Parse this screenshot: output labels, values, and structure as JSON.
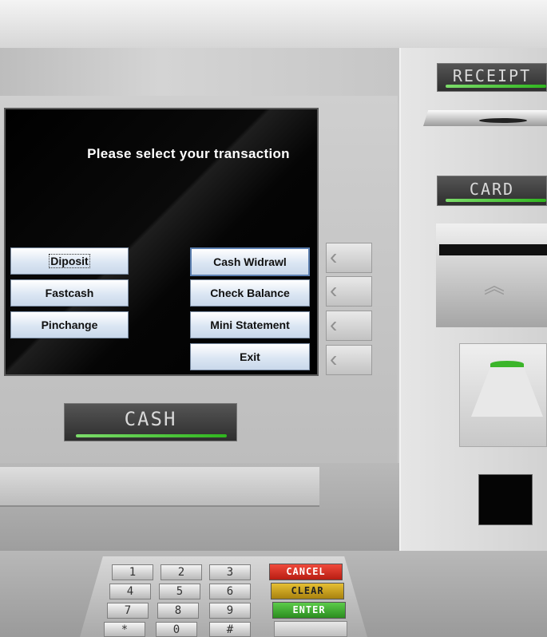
{
  "screen": {
    "prompt": "Please select your transaction",
    "buttons_left": [
      "Diposit",
      "Fastcash",
      "Pinchange"
    ],
    "buttons_right": [
      "Cash Widrawl",
      "Check Balance",
      "Mini Statement",
      "Exit"
    ]
  },
  "side_key_glyph": "‹",
  "labels": {
    "receipt": "RECEIPT",
    "card": "CARD",
    "cash": "CASH"
  },
  "card_chevron": "︽",
  "keypad": {
    "keys": [
      "1",
      "2",
      "3",
      "4",
      "5",
      "6",
      "7",
      "8",
      "9",
      "*",
      "0",
      "#"
    ],
    "cancel": "CANCEL",
    "clear": "CLEAR",
    "enter": "ENTER"
  },
  "colors": {
    "cancel": "#d62b1f",
    "clear": "#c9a21b",
    "enter": "#3aa52c",
    "led_green": "#3bb52a"
  }
}
